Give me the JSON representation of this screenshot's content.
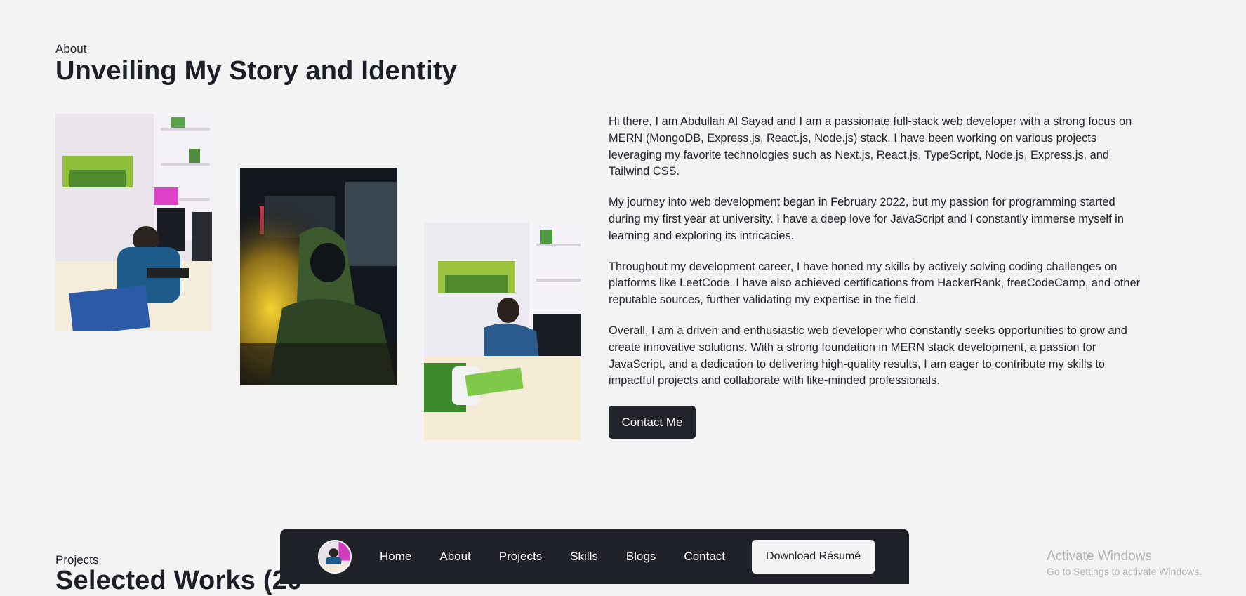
{
  "about": {
    "eyebrow": "About",
    "heading": "Unveiling My Story and Identity",
    "paragraphs": [
      "Hi there, I am Abdullah Al Sayad and I am a passionate full-stack web developer with a strong focus on MERN (MongoDB, Express.js, React.js, Node.js) stack. I have been working on various projects leveraging my favorite technologies such as Next.js, React.js, TypeScript, Node.js, Express.js, and Tailwind CSS.",
      "My journey into web development began in February 2022, but my passion for programming started during my first year at university. I have a deep love for JavaScript and I constantly immerse myself in learning and exploring its intricacies.",
      "Throughout my development career, I have honed my skills by actively solving coding challenges on platforms like LeetCode. I have also achieved certifications from HackerRank, freeCodeCamp, and other reputable sources, further validating my expertise in the field.",
      "Overall, I am a driven and enthusiastic web developer who constantly seeks opportunities to grow and create innovative solutions. With a strong foundation in MERN stack development, a passion for JavaScript, and a dedication to delivering high-quality results, I am eager to contribute my skills to impactful projects and collaborate with like-minded professionals."
    ],
    "contact_label": "Contact Me"
  },
  "projects": {
    "eyebrow": "Projects",
    "heading": "Selected Works (20"
  },
  "dock": {
    "links": [
      "Home",
      "About",
      "Projects",
      "Skills",
      "Blogs",
      "Contact"
    ],
    "resume_label": "Download Résumé"
  },
  "watermark": {
    "title": "Activate Windows",
    "subtitle": "Go to Settings to activate Windows."
  },
  "colors": {
    "background": "#f3f3f3",
    "dark": "#22242c",
    "text": "#23242c"
  }
}
